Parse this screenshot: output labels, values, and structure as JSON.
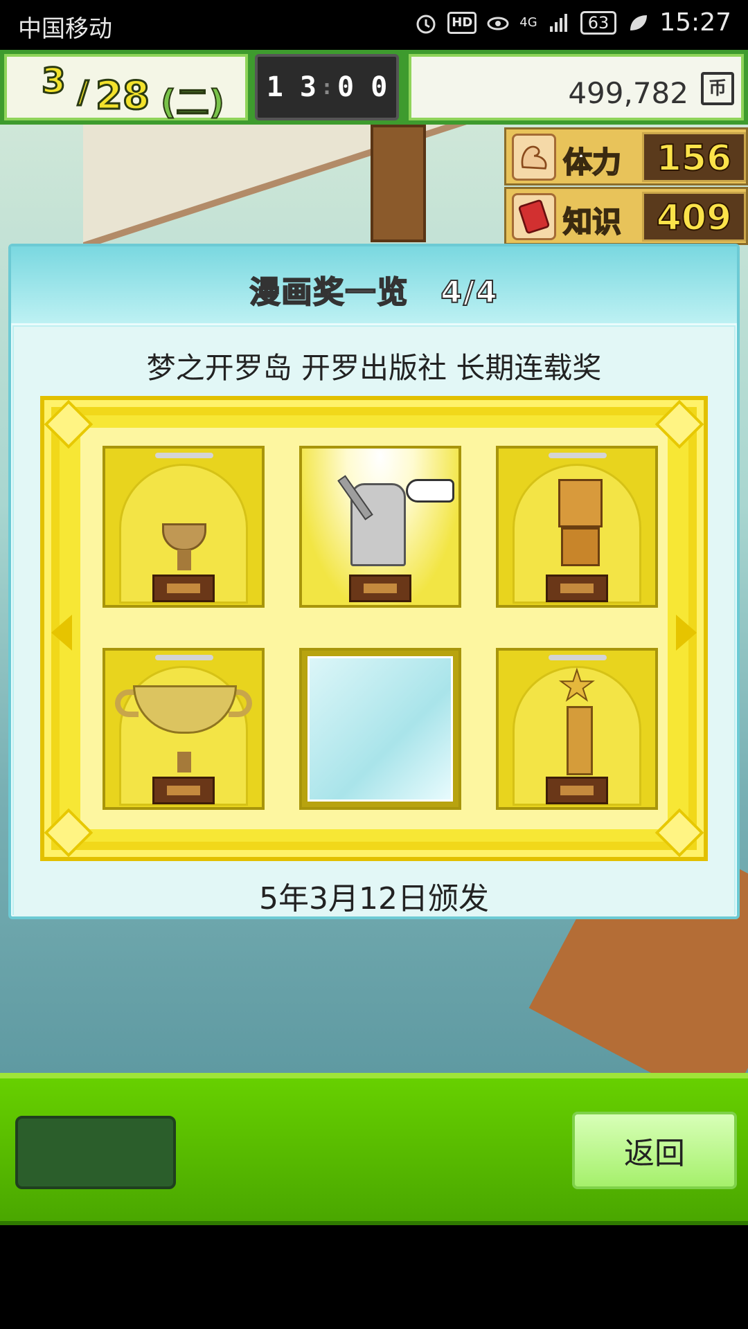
{
  "statusbar": {
    "carrier": "中国移动",
    "hd": "HD",
    "network": "4G",
    "battery": "63",
    "time": "15:27"
  },
  "hud": {
    "month": "3",
    "slash": "/",
    "day": "28",
    "weekday": "(二)",
    "clock_hours": "1 3",
    "clock_sep": ":",
    "clock_minutes": "0 0",
    "money": "499,782",
    "currency": "币"
  },
  "stats": [
    {
      "label": "体力",
      "value": "156",
      "icon": "muscle-icon"
    },
    {
      "label": "知识",
      "value": "409",
      "icon": "book-icon"
    }
  ],
  "dialog": {
    "title": "漫画奖一览　4/4",
    "subtitle": "梦之开罗岛 开罗出版社 长期连载奖",
    "date": "5年3月12日颁发",
    "trophies": [
      {
        "name": "small-bronze-cup",
        "state": "obtained"
      },
      {
        "name": "silver-pen-statue",
        "state": "selected"
      },
      {
        "name": "robot-statue",
        "state": "obtained"
      },
      {
        "name": "large-gold-cup",
        "state": "obtained"
      },
      {
        "name": "empty-slot",
        "state": "empty"
      },
      {
        "name": "star-tower-trophy",
        "state": "obtained"
      }
    ]
  },
  "bottom": {
    "back_label": "返回"
  },
  "colors": {
    "hud_green": "#3e9b2e",
    "dialog_bg": "#bfeff1",
    "frame_yellow": "#f7e735",
    "bottom_green": "#5bbf00"
  }
}
